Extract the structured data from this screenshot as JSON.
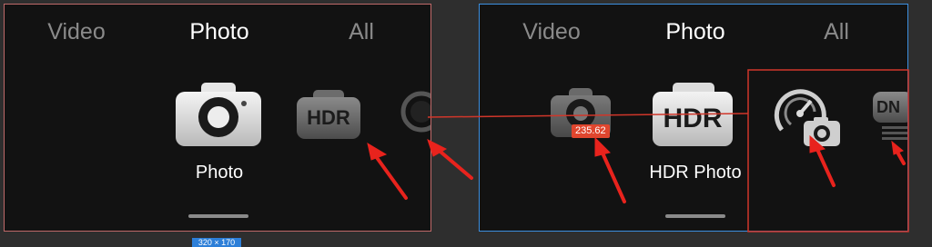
{
  "left_panel": {
    "tabs": [
      {
        "label": "Video"
      },
      {
        "label": "Photo",
        "active": true
      },
      {
        "label": "All"
      }
    ],
    "modes": [
      {
        "name": "photo-mode",
        "label": "Photo"
      },
      {
        "name": "hdr-mode",
        "icon_text": "HDR"
      },
      {
        "name": "partial-mode-icon"
      }
    ]
  },
  "right_panel": {
    "tabs": [
      {
        "label": "Video"
      },
      {
        "label": "Photo",
        "active": true
      },
      {
        "label": "All"
      }
    ],
    "modes": [
      {
        "name": "photo-mode",
        "badge": "235.62"
      },
      {
        "name": "hdr-mode",
        "icon_text": "HDR",
        "label": "HDR Photo"
      },
      {
        "name": "speed-camera-mode"
      },
      {
        "name": "dng-mode",
        "icon_text": "DN"
      }
    ]
  },
  "annotations": {
    "dimension_tag": "320 × 170"
  },
  "colors": {
    "left_frame": "#c06a6a",
    "right_frame": "#3c8fe0",
    "arrow": "#e8231d",
    "connector": "#d0362a",
    "badge": "#e0462e"
  }
}
